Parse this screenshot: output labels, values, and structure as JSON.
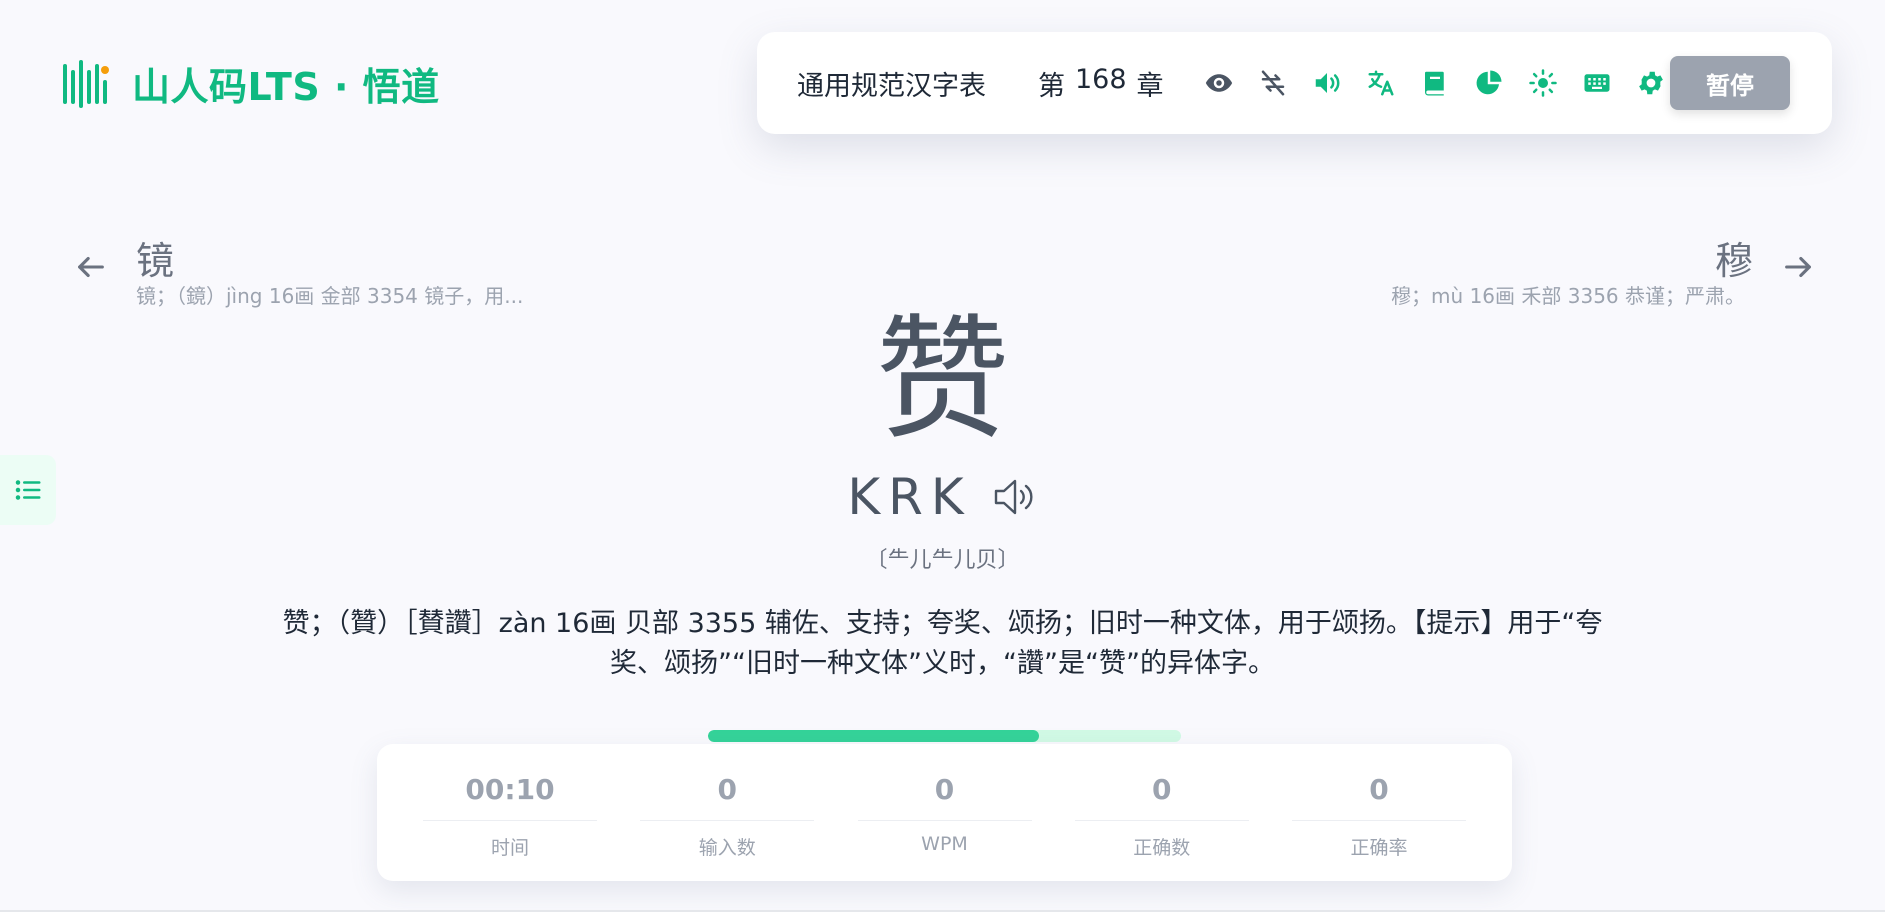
{
  "app": {
    "title": "山人码LTS · 悟道",
    "accent_color": "#10b981"
  },
  "toolbar": {
    "dict_name": "通用规范汉字表",
    "chapter_prefix": "第",
    "chapter_number": "168",
    "chapter_suffix": "章",
    "icons": [
      "eye-icon",
      "loop-off-icon",
      "volume-icon",
      "translate-icon",
      "book-icon",
      "pie-chart-icon",
      "sun-icon",
      "keyboard-icon",
      "gear-icon"
    ],
    "pause_label": "暂停"
  },
  "prev": {
    "char": "镜",
    "desc": "镜；（鏡）jìng 16画 金部 3354 镜子，用..."
  },
  "next": {
    "char": "穆",
    "desc": "穆；mù 16画 禾部 3356 恭谨；严肃。"
  },
  "current": {
    "char": "赞",
    "code": "KRK",
    "decomposition": "〔⺧儿⺧儿贝〕",
    "definition": "赞；（贊）［賛讚］zàn 16画 贝部 3355 辅佐、支持；夸奖、颂扬；旧时一种文体，用于颂扬。【提示】用于“夸奖、颂扬”“旧时一种文体”义时，“讚”是“赞”的异体字。"
  },
  "progress": {
    "fraction": 0.7
  },
  "stats": [
    {
      "value": "00:10",
      "label": "时间"
    },
    {
      "value": "0",
      "label": "输入数"
    },
    {
      "value": "0",
      "label": "WPM"
    },
    {
      "value": "0",
      "label": "正确数"
    },
    {
      "value": "0",
      "label": "正确率"
    }
  ]
}
